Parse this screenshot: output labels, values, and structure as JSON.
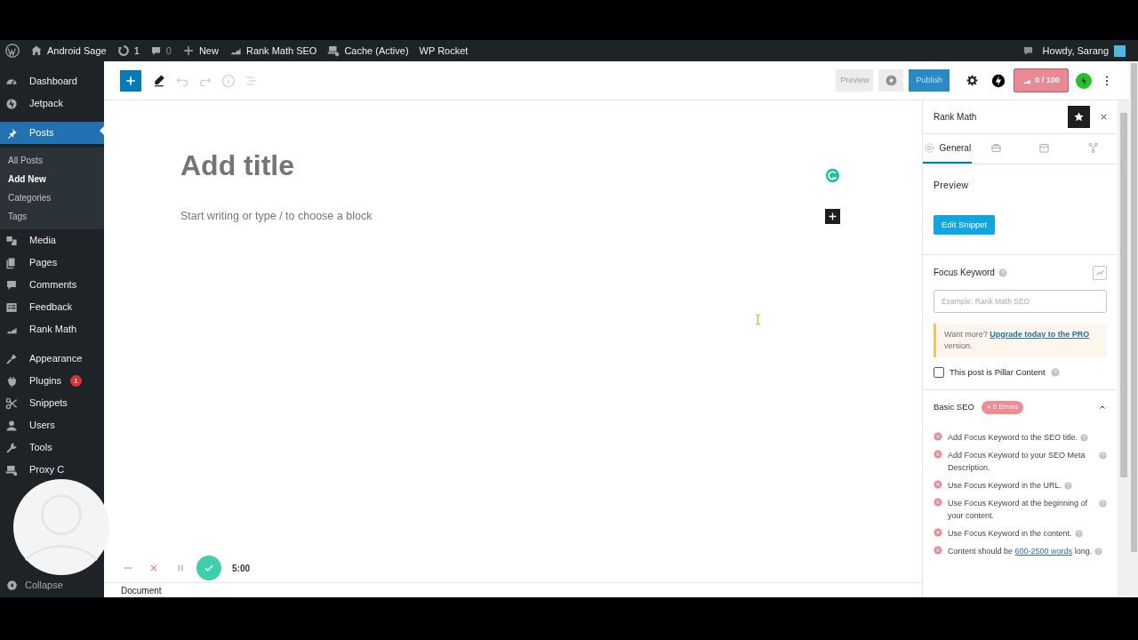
{
  "admin_bar": {
    "items": [
      {
        "kind": "logo"
      },
      {
        "kind": "home",
        "label": "Android Sage"
      },
      {
        "kind": "updates",
        "label": "1"
      },
      {
        "kind": "comments",
        "label": "0"
      },
      {
        "kind": "new",
        "label": "New"
      },
      {
        "kind": "rankmath",
        "label": "Rank Math SEO"
      },
      {
        "kind": "cache",
        "label": "Cache (Active)"
      },
      {
        "kind": "text",
        "label": "WP Rocket"
      }
    ],
    "greeting": "Howdy, Sarang"
  },
  "sidebar": {
    "items": [
      {
        "label": "Dashboard",
        "kind": "dashboard",
        "selected": false
      },
      {
        "label": "Jetpack",
        "kind": "jetpack",
        "selected": false
      },
      {
        "label": "Posts",
        "kind": "pin",
        "selected": true,
        "children": [
          {
            "label": "All Posts",
            "selected": false
          },
          {
            "label": "Add New",
            "selected": true
          },
          {
            "label": "Categories",
            "selected": false
          },
          {
            "label": "Tags",
            "selected": false
          }
        ]
      },
      {
        "label": "Media",
        "kind": "media",
        "selected": false
      },
      {
        "label": "Pages",
        "kind": "pages",
        "selected": false
      },
      {
        "label": "Comments",
        "kind": "comments",
        "selected": false
      },
      {
        "label": "Feedback",
        "kind": "feedback",
        "selected": false
      },
      {
        "label": "Rank Math",
        "kind": "rankmath",
        "selected": false
      },
      {
        "label": "Appearance",
        "kind": "brush",
        "selected": false
      },
      {
        "label": "Plugins",
        "kind": "plug",
        "selected": false,
        "badge": "1"
      },
      {
        "label": "Snippets",
        "kind": "scissors",
        "selected": false
      },
      {
        "label": "Users",
        "kind": "user",
        "selected": false
      },
      {
        "label": "Tools",
        "kind": "wrench",
        "selected": false
      },
      {
        "label": "Proxy C",
        "kind": "cache",
        "selected": false
      }
    ],
    "collapse": "Collapse"
  },
  "toolbar": {
    "preview": "Preview",
    "publish": "Publish",
    "score": "0 / 100"
  },
  "editor": {
    "title_placeholder": "Add title",
    "body_placeholder": "Start writing or type / to choose a block"
  },
  "footer": {
    "breadcrumb": "Document"
  },
  "panel": {
    "title": "Rank Math",
    "tabs": [
      {
        "kind": "gear",
        "label": "General",
        "selected": true
      },
      {
        "kind": "briefcase",
        "selected": false
      },
      {
        "kind": "calendar",
        "selected": false
      },
      {
        "kind": "share",
        "selected": false
      }
    ],
    "preview_heading": "Preview",
    "edit_snippet": "Edit Snippet",
    "focus_label": "Focus Keyword",
    "focus_placeholder": "Example: Rank Math SEO",
    "notice": {
      "text": "Want more?",
      "link": "Upgrade today to the PRO",
      "after": "version."
    },
    "pillar": {
      "label": "This post is Pillar Content",
      "checked": false
    },
    "basic_seo": {
      "title": "Basic SEO",
      "badge": "× 6 Errors",
      "expanded": true,
      "checks": [
        {
          "text": "Add Focus Keyword to the SEO title."
        },
        {
          "text": "Add Focus Keyword to your SEO Meta Description."
        },
        {
          "text": "Use Focus Keyword in the URL."
        },
        {
          "text": "Use Focus Keyword at the beginning of your content."
        },
        {
          "text": "Use Focus Keyword in the content."
        },
        {
          "text": "Content should be",
          "link": "600-2500 words",
          "after": "long."
        }
      ]
    }
  },
  "recorder": {
    "timer": "5:00"
  }
}
